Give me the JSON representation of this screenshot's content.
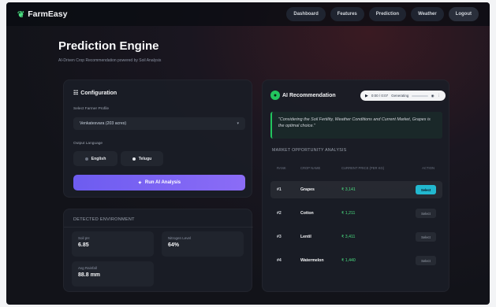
{
  "nav": {
    "brand": "FarmEasy",
    "links": [
      "Dashboard",
      "Features",
      "Prediction",
      "Weather",
      "Logout"
    ]
  },
  "header": {
    "title": "Prediction Engine",
    "subtitle": "AI-Driven Crop Recommendation powered by Soil Analysis"
  },
  "config": {
    "title": "Configuration",
    "farmer_label": "Select Farmer Profile",
    "farmer_value": "Venkatesvara (203 acres)",
    "language_label": "Output Language",
    "languages": [
      "English",
      "Telugu"
    ],
    "run_label": "Run AI Analysis"
  },
  "environment": {
    "title": "DETECTED ENVIRONMENT",
    "stats": [
      {
        "key": "Soil pH",
        "value": "6.85"
      },
      {
        "key": "Nitrogen Level",
        "value": "64%"
      },
      {
        "key": "Avg Rainfall",
        "value": "88.8 mm"
      }
    ]
  },
  "ai": {
    "title": "AI Recommendation",
    "audio_time": "0:00 / 0:07",
    "audio_status": "Generating",
    "quote": "\"Considering the Soil Fertility, Weather Conditions and Current Market, Grapes is the optimal choice.\"",
    "market_title": "MARKET OPPORTUNITY ANALYSIS",
    "columns": [
      "RANK",
      "CROP NAME",
      "CURRENT PRICE (PER KG)",
      "ACTION"
    ],
    "rows": [
      {
        "rank": "#1",
        "crop": "Grapes",
        "price": "₹ 3,141",
        "action": "Select"
      },
      {
        "rank": "#2",
        "crop": "Cotton",
        "price": "₹ 1,211",
        "action": "Select"
      },
      {
        "rank": "#3",
        "crop": "Lentil",
        "price": "₹ 3,411",
        "action": "Select"
      },
      {
        "rank": "#4",
        "crop": "Watermelon",
        "price": "₹ 1,440",
        "action": "Select"
      }
    ]
  }
}
